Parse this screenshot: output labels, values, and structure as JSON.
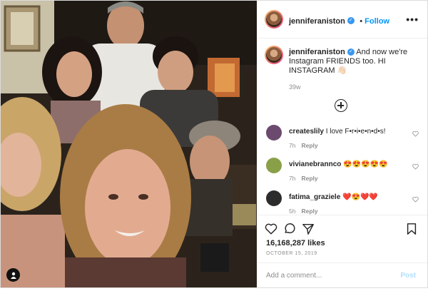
{
  "post": {
    "username": "jenniferaniston",
    "follow_label": "Follow",
    "more_icon": "•••",
    "caption_user": "jenniferaniston",
    "caption_text": "And now we're Instagram FRIENDS too. HI INSTAGRAM 👋🏻",
    "caption_age": "39w",
    "likes": "16,168,287 likes",
    "date": "OCTOBER 15, 2019",
    "add_comment_placeholder": "Add a comment...",
    "post_label": "Post"
  },
  "comments": [
    {
      "user": "createslily",
      "text": "I love F•r•i•e•n•d•s!",
      "age": "7h",
      "reply": "Reply",
      "avatar_color": "#6b4a6e"
    },
    {
      "user": "vivianebrannco",
      "text": "😍😍😍😍😍",
      "age": "7h",
      "reply": "Reply",
      "avatar_color": "#8aa048"
    },
    {
      "user": "fatima_graziele",
      "text": "❤️😍❤️❤️",
      "age": "5h",
      "reply": "Reply",
      "avatar_color": "#2c2c2c"
    }
  ],
  "colors": {
    "accent": "#0095f6",
    "verified": "#3897f0",
    "muted": "#8e8e8e"
  }
}
